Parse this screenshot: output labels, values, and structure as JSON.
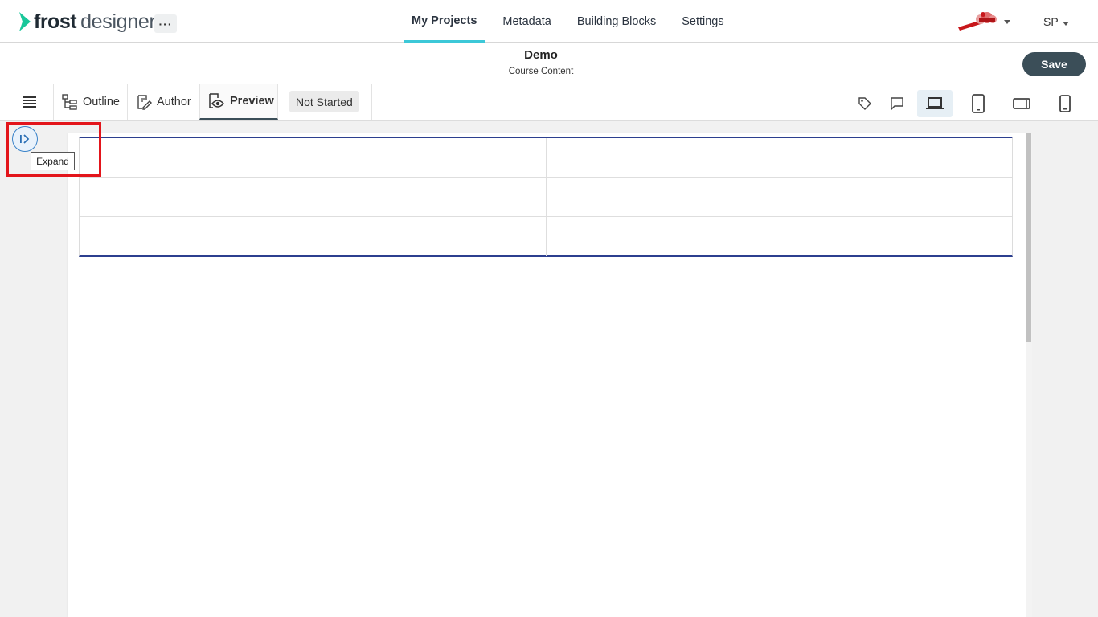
{
  "app": {
    "logo_bold": "frost",
    "logo_light": "designer",
    "more_label": "···"
  },
  "nav": {
    "items": [
      "My Projects",
      "Metadata",
      "Building Blocks",
      "Settings"
    ],
    "active": "My Projects"
  },
  "user": {
    "initials": "SP"
  },
  "project": {
    "title": "Demo",
    "subtitle": "Course Content",
    "save_label": "Save"
  },
  "toolbar": {
    "tabs": [
      {
        "label": "Outline",
        "icon": "outline-icon"
      },
      {
        "label": "Author",
        "icon": "author-icon"
      },
      {
        "label": "Preview",
        "icon": "preview-icon"
      }
    ],
    "active_tab": "Preview",
    "status": "Not Started",
    "tools": [
      "tag-icon",
      "comment-icon",
      "laptop-icon",
      "tablet-icon",
      "tablet-landscape-icon",
      "phone-icon"
    ],
    "selected_tool": "laptop-icon"
  },
  "expand": {
    "tooltip": "Expand"
  },
  "table": {
    "rows": [
      [
        "",
        ""
      ],
      [
        "",
        ""
      ],
      [
        "",
        ""
      ]
    ]
  },
  "colors": {
    "accent": "#3cc8d8",
    "save_bg": "#3b4e58",
    "table_border": "#2c3f8f",
    "highlight": "#e3151b"
  }
}
